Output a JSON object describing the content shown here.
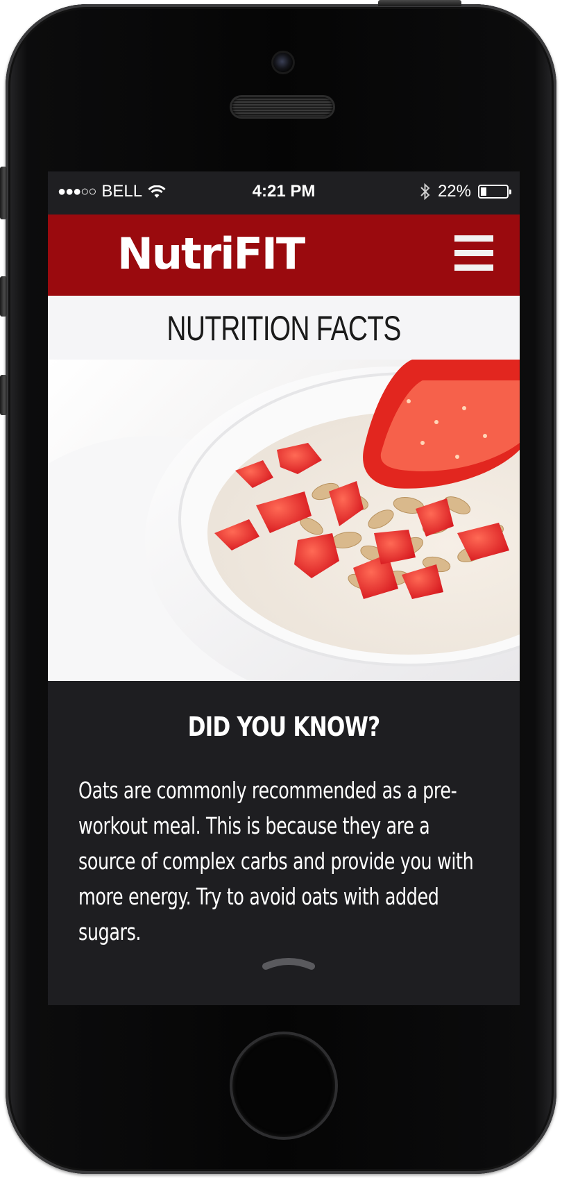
{
  "status_bar": {
    "signal": "●●●○○",
    "carrier": "BELL",
    "time": "4:21 PM",
    "battery_percent": "22%",
    "battery_level": 0.22,
    "wifi_icon": "wifi-icon",
    "bluetooth_icon": "bluetooth-icon"
  },
  "header": {
    "app_name": "NutriFIT",
    "menu_icon": "hamburger-menu-icon",
    "brand_color": "#9a0a0e"
  },
  "page": {
    "title": "NUTRITION FACTS"
  },
  "hero_image": {
    "subject": "yogurt bowl with oats and strawberries"
  },
  "info": {
    "heading": "DID YOU KNOW?",
    "body": "Oats are commonly recommended as a pre-workout meal. This is because they are a source of complex carbs and provide you with more energy. Try to avoid oats with added sugars.",
    "handle_icon": "chevron-up-icon"
  }
}
